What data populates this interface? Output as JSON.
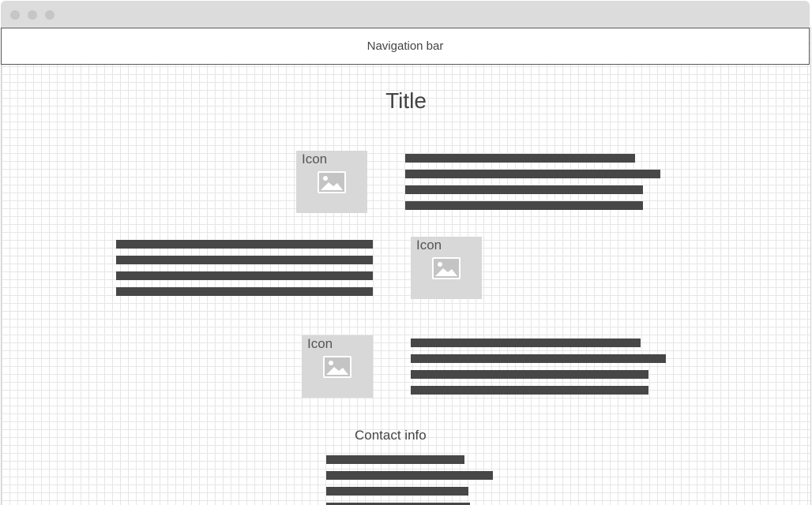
{
  "window": {
    "controls": [
      "close-dot",
      "minimize-dot",
      "zoom-dot"
    ]
  },
  "navbar": {
    "label": "Navigation bar"
  },
  "page": {
    "title": "Title"
  },
  "features": [
    {
      "icon_label": "Icon",
      "icon": "image-placeholder-icon",
      "text_lines": 4
    },
    {
      "icon_label": "Icon",
      "icon": "image-placeholder-icon",
      "text_lines": 4
    },
    {
      "icon_label": "Icon",
      "icon": "image-placeholder-icon",
      "text_lines": 4
    }
  ],
  "contact": {
    "heading": "Contact info",
    "text_lines": 4
  },
  "colors": {
    "placeholder_text_bar": "#474747",
    "icon_box": "#d8d8d8",
    "grid_line": "#e6e6e6",
    "titlebar": "#dcdcdc"
  }
}
